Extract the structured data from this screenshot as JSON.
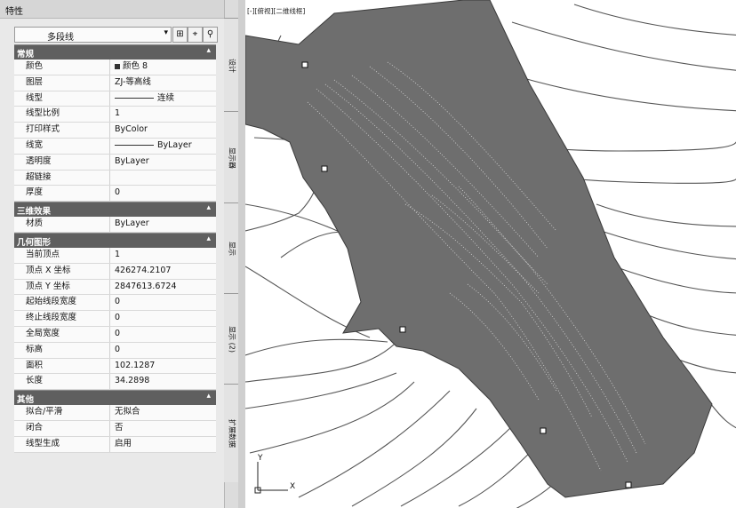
{
  "palette": {
    "title": "特性",
    "selection": "多段线",
    "side_tabs": [
      "设计",
      "显示器",
      "显示",
      "显示 (2)",
      "扩展数据"
    ],
    "sections": [
      {
        "title": "常规",
        "collapse": "▴",
        "rows": [
          {
            "key": "颜色",
            "value": "颜色 8"
          },
          {
            "key": "图层",
            "value": "ZJ-等高线"
          },
          {
            "key": "线型",
            "value": "连续"
          },
          {
            "key": "线型比例",
            "value": "1"
          },
          {
            "key": "打印样式",
            "value": "ByColor"
          },
          {
            "key": "线宽",
            "value": "ByLayer"
          },
          {
            "key": "透明度",
            "value": "ByLayer"
          },
          {
            "key": "超链接",
            "value": ""
          },
          {
            "key": "厚度",
            "value": "0"
          }
        ]
      },
      {
        "title": "三维效果",
        "collapse": "▴",
        "rows": [
          {
            "key": "材质",
            "value": "ByLayer"
          }
        ]
      },
      {
        "title": "几何图形",
        "collapse": "▴",
        "rows": [
          {
            "key": "当前顶点",
            "value": "1"
          },
          {
            "key": "顶点 X 坐标",
            "value": "426274.2107"
          },
          {
            "key": "顶点 Y 坐标",
            "value": "2847613.6724"
          },
          {
            "key": "起始线段宽度",
            "value": "0"
          },
          {
            "key": "终止线段宽度",
            "value": "0"
          },
          {
            "key": "全局宽度",
            "value": "0"
          },
          {
            "key": "标高",
            "value": "0"
          },
          {
            "key": "面积",
            "value": "102.1287"
          },
          {
            "key": "长度",
            "value": "34.2898"
          }
        ]
      },
      {
        "title": "其他",
        "collapse": "▴",
        "rows": [
          {
            "key": "拟合/平滑",
            "value": "无拟合"
          },
          {
            "key": "闭合",
            "value": "否"
          },
          {
            "key": "线型生成",
            "value": "启用"
          }
        ]
      }
    ]
  },
  "viewport": {
    "label": "[-][俯视][二维线框]",
    "ucs_x": "X",
    "ucs_y": "Y"
  },
  "colors": {
    "hatch": "#6e6e6e",
    "section_header": "#5f5f5f",
    "panel_bg": "#e9e9e9"
  }
}
